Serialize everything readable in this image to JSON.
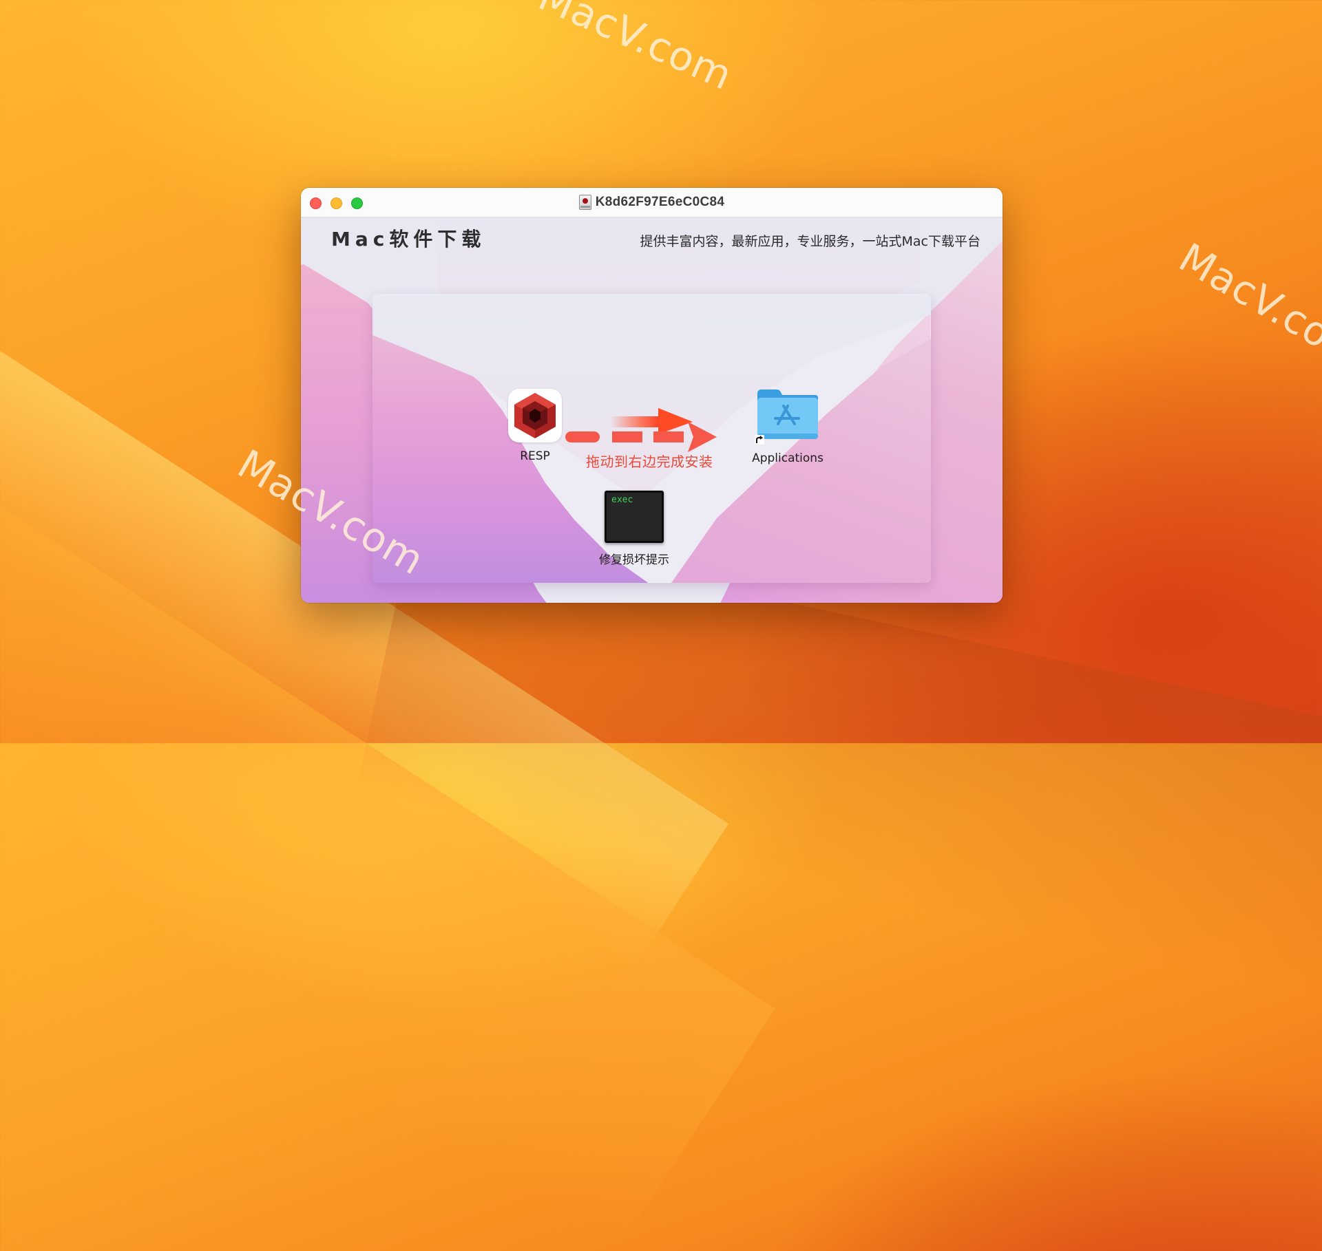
{
  "desktop": {
    "watermarks": [
      "MacV.com",
      "MacV.co",
      "MacV.com"
    ]
  },
  "window": {
    "title": "K8d62F97E6eC0C84",
    "title_icon": "disk-image-icon",
    "traffic_lights": {
      "close_color": "#fe5f57",
      "minimize_color": "#febc2e",
      "maximize_color": "#28c840"
    }
  },
  "header": {
    "title": "Mac软件下载",
    "subtitle": "提供丰富内容，最新应用，专业服务，一站式Mac下载平台"
  },
  "installer": {
    "app": {
      "label": "RESP",
      "icon": "resp-app-icon"
    },
    "target": {
      "label": "Applications",
      "icon": "applications-folder-icon"
    },
    "instruction": "拖动到右边完成安装",
    "instruction_color": "#e84a3a",
    "repair": {
      "label": "修复损坏提示",
      "icon_text": "exec",
      "icon": "exec-terminal-icon"
    }
  }
}
